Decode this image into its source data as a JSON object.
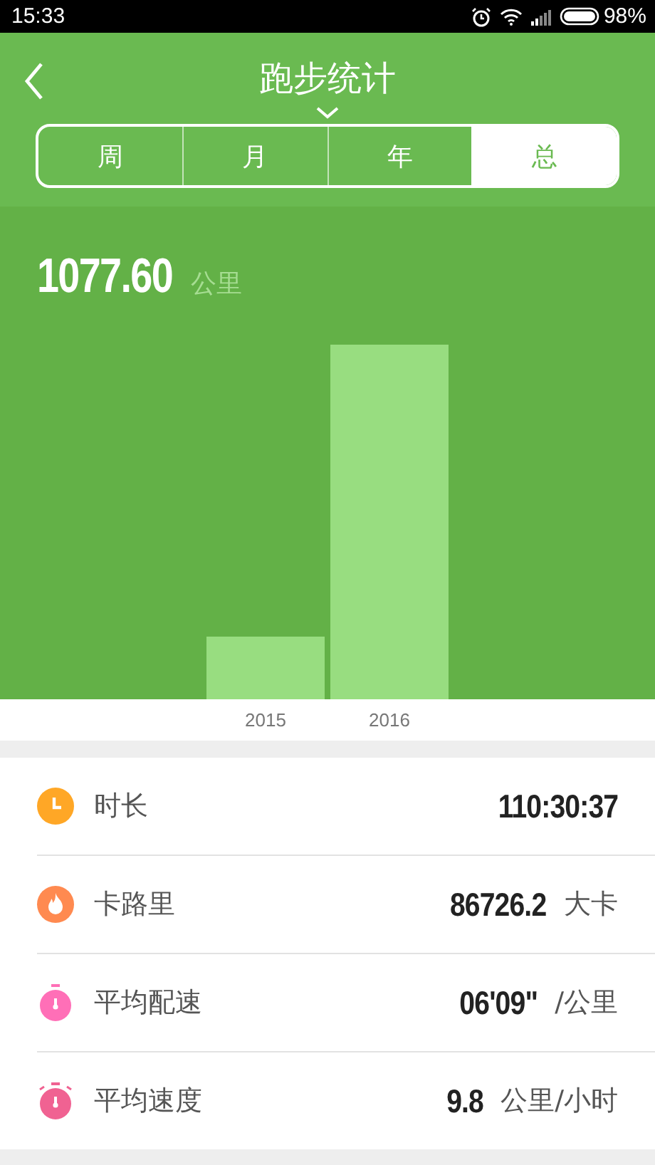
{
  "status_bar": {
    "time": "15:33",
    "battery": "98%"
  },
  "header": {
    "title": "跑步统计"
  },
  "tabs": [
    {
      "label": "周",
      "selected": false
    },
    {
      "label": "月",
      "selected": false
    },
    {
      "label": "年",
      "selected": false
    },
    {
      "label": "总",
      "selected": true
    }
  ],
  "total": {
    "value": "1077.60",
    "unit": "公里"
  },
  "bars": [
    {
      "label": "2015"
    },
    {
      "label": "2016"
    }
  ],
  "stats": [
    {
      "kind": "clock",
      "color": "#ffa726",
      "label": "时长",
      "value": "110:30:37"
    },
    {
      "kind": "flame",
      "color": "#ff8a50",
      "label": "卡路里",
      "value": "86726.2",
      "unit": "大卡"
    },
    {
      "kind": "stopwatch",
      "color": "#ff6fb7",
      "label": "平均配速",
      "value": "06'09\"",
      "unit": "/公里"
    },
    {
      "kind": "timer",
      "color": "#f06292",
      "label": "平均速度",
      "value": "9.8",
      "unit": "公里/小时"
    }
  ]
}
